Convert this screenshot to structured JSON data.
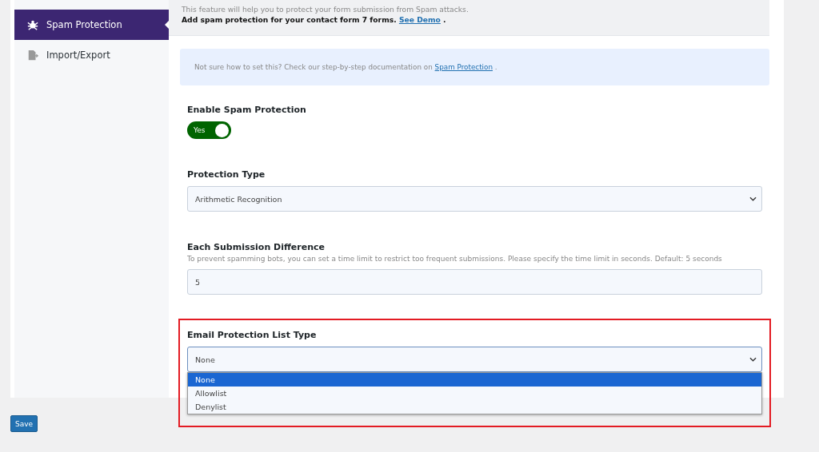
{
  "sidebar": {
    "items": [
      {
        "label": "Spam Protection",
        "selected": true
      },
      {
        "label": "Import/Export",
        "selected": false
      }
    ]
  },
  "header": {
    "description": "This feature will help you to protect your form submission from Spam attacks.",
    "promo": "Add spam protection for your contact form 7 forms.",
    "promo_link": "See Demo",
    "promo_end": "."
  },
  "notice": {
    "text": "Not sure how to set this? Check our step-by-step documentation on",
    "link": "Spam Protection",
    "end": "."
  },
  "fields": [
    {
      "kind": "toggle",
      "label": "Enable Spam Protection",
      "on": true,
      "on_text": "Yes"
    },
    {
      "kind": "select",
      "label": "Protection Type",
      "value": "Arithmetic Recognition"
    },
    {
      "kind": "input",
      "label": "Each Submission Difference",
      "help": "To prevent spamming bots, you can set a time limit to restrict too frequent submissions. Please specify the time limit in seconds. Default: 5 seconds",
      "value": "5"
    }
  ],
  "email_list": {
    "label": "Email Protection List Type",
    "value": "None",
    "expanded": true,
    "options": [
      {
        "label": "None",
        "selected": true
      },
      {
        "label": "Allowlist",
        "selected": false
      },
      {
        "label": "Denylist",
        "selected": false
      }
    ]
  },
  "save_button": "Save"
}
